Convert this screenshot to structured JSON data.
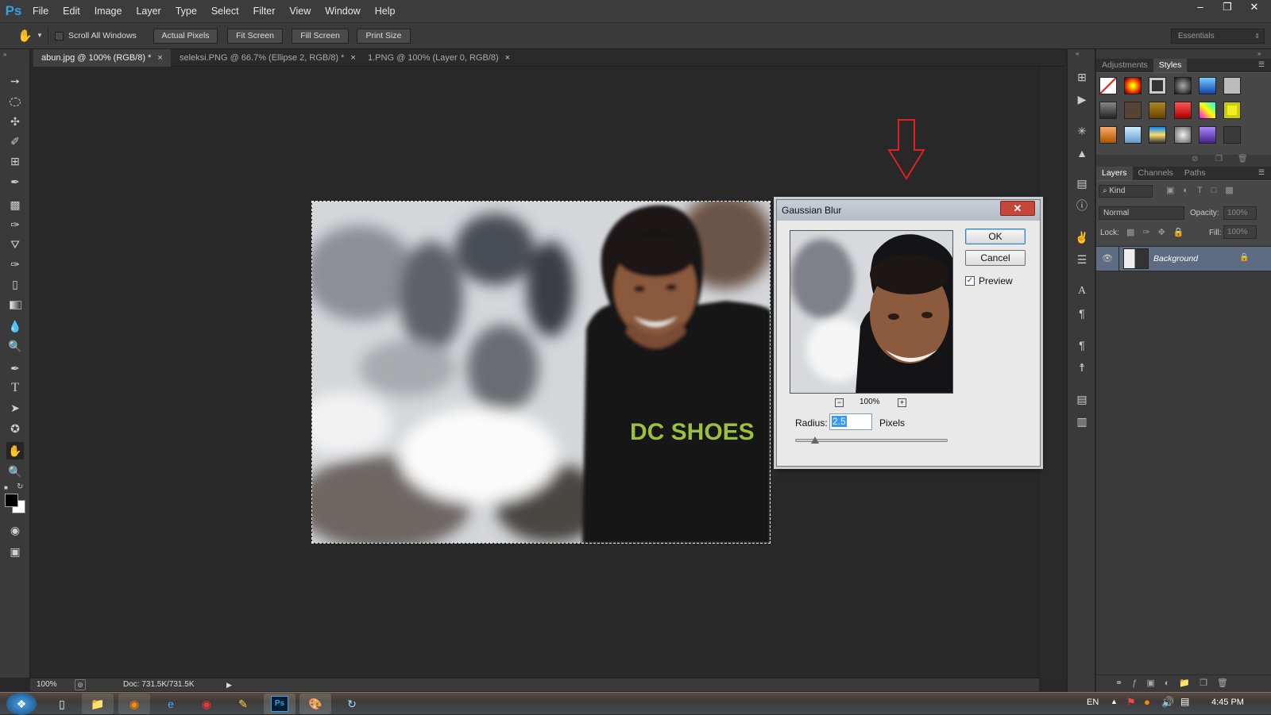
{
  "app": {
    "logo": "Ps"
  },
  "menu": [
    "File",
    "Edit",
    "Image",
    "Layer",
    "Type",
    "Select",
    "Filter",
    "View",
    "Window",
    "Help"
  ],
  "options": {
    "scroll_all_windows": "Scroll All Windows",
    "buttons": [
      "Actual Pixels",
      "Fit Screen",
      "Fill Screen",
      "Print Size"
    ],
    "workspace": "Essentials"
  },
  "tabs": [
    {
      "label": "abun.jpg @ 100% (RGB/8) *",
      "active": true
    },
    {
      "label": "seleksi.PNG @ 66.7% (Ellipse 2, RGB/8) *",
      "active": false
    },
    {
      "label": "1.PNG @ 100% (Layer 0, RGB/8)",
      "active": false
    }
  ],
  "status": {
    "zoom": "100%",
    "doc": "Doc: 731.5K/731.5K"
  },
  "dialog": {
    "title": "Gaussian Blur",
    "ok": "OK",
    "cancel": "Cancel",
    "preview_label": "Preview",
    "preview_checked": true,
    "zoom": "100%",
    "radius_label": "Radius:",
    "radius_value": "2.5",
    "radius_unit": "Pixels",
    "radius_slider_fraction": 0.13
  },
  "image": {
    "shirt_text": "DC SHOES"
  },
  "panels": {
    "adjustments_tab": "Adjustments",
    "styles_tab": "Styles",
    "layers_tab": "Layers",
    "channels_tab": "Channels",
    "paths_tab": "Paths",
    "kind": "Kind",
    "blend_mode": "Normal",
    "opacity_label": "Opacity:",
    "opacity_value": "100%",
    "lock_label": "Lock:",
    "fill_label": "Fill:",
    "fill_value": "100%",
    "layer_name": "Background"
  },
  "taskbar": {
    "lang": "EN",
    "time": "4:45 PM"
  },
  "colors": {
    "accent_blue": "#3a9fe0",
    "highlight": "#3399ff",
    "arrow": "#e02020"
  }
}
